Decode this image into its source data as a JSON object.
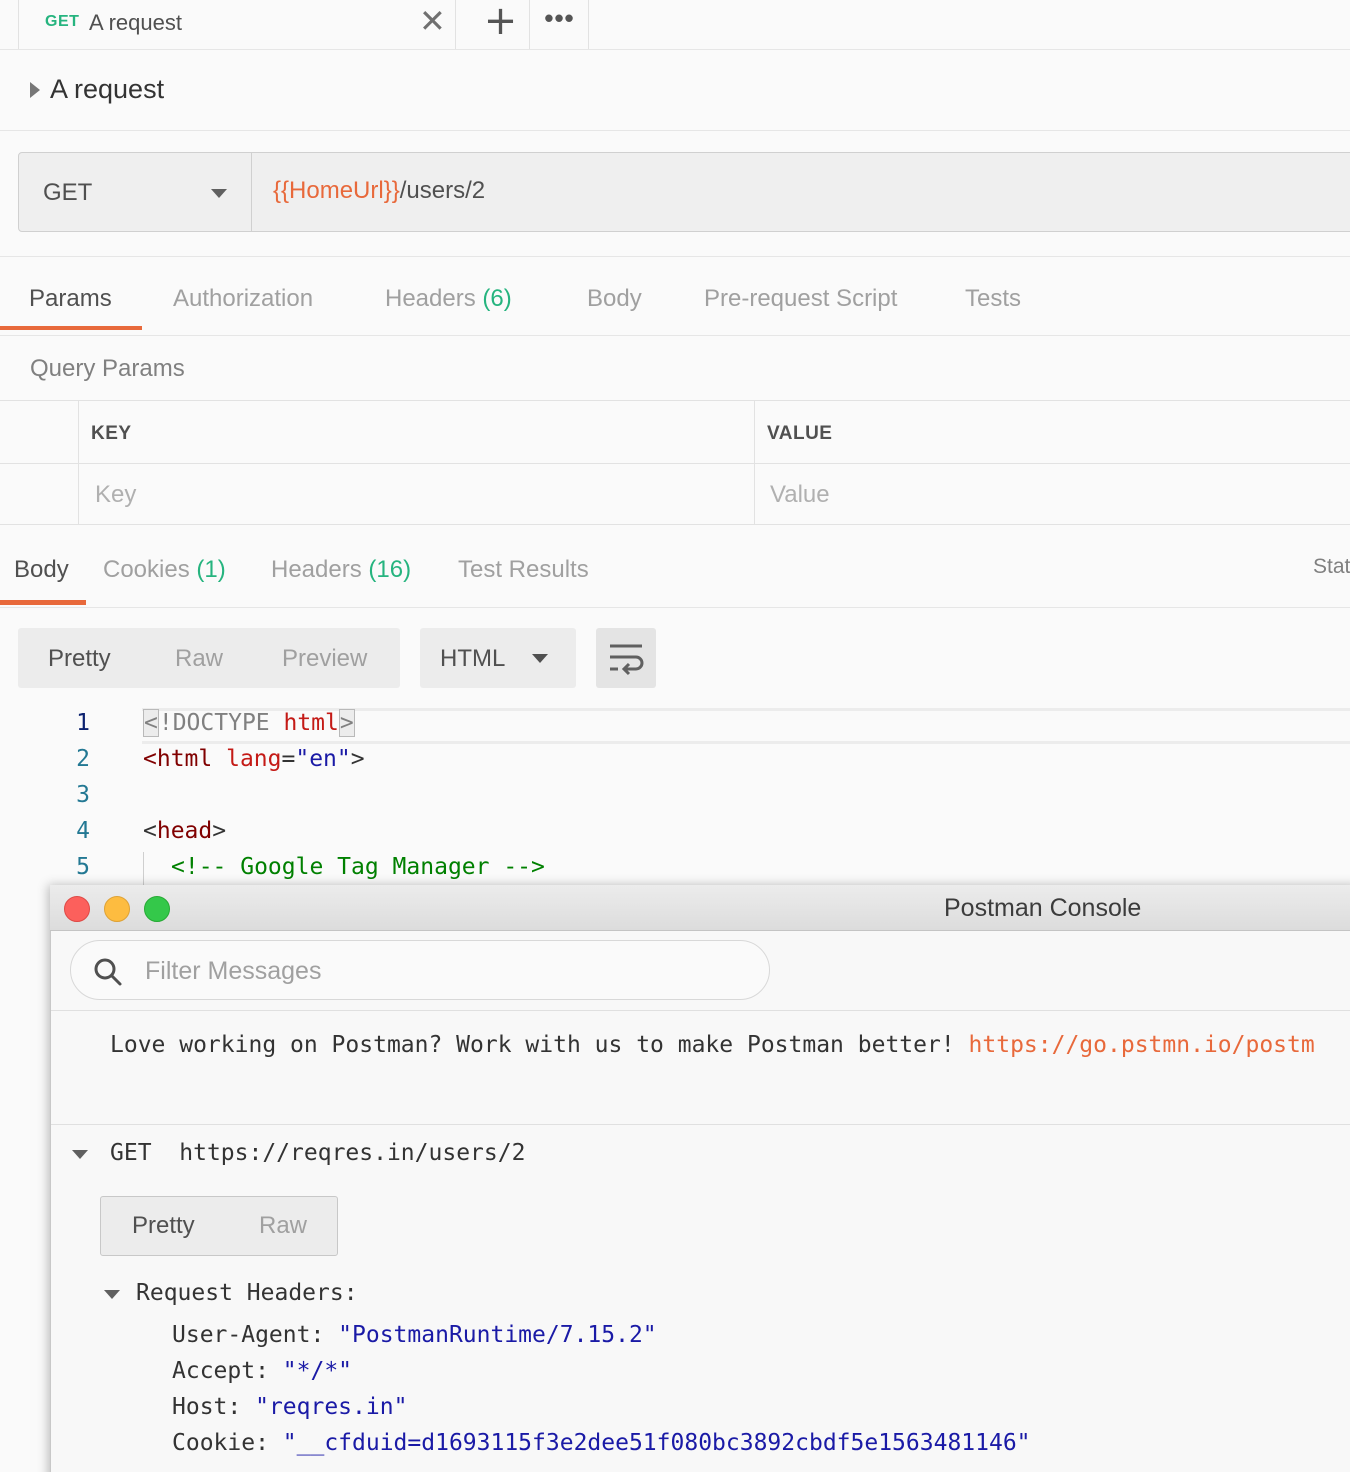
{
  "tab": {
    "method": "GET",
    "name": "A request",
    "close_glyph": "✕",
    "plus_glyph": "+",
    "more_glyph": "•••"
  },
  "request": {
    "title": "A request",
    "method": "GET",
    "url_var": "{{HomeUrl}}",
    "url_path": "/users/2"
  },
  "req_tabs": {
    "params": "Params",
    "authorization": "Authorization",
    "headers": "Headers",
    "headers_count": "(6)",
    "body": "Body",
    "prerequest": "Pre-request Script",
    "tests": "Tests"
  },
  "query_params": {
    "label": "Query Params",
    "key_header": "KEY",
    "value_header": "VALUE",
    "key_placeholder": "Key",
    "value_placeholder": "Value"
  },
  "resp_tabs": {
    "body": "Body",
    "cookies": "Cookies",
    "cookies_count": "(1)",
    "headers": "Headers",
    "headers_count": "(16)",
    "test_results": "Test Results",
    "status_trunc": "Stat"
  },
  "view": {
    "pretty": "Pretty",
    "raw": "Raw",
    "preview": "Preview",
    "language": "HTML"
  },
  "code": {
    "line_numbers": [
      "1",
      "2",
      "3",
      "4",
      "5"
    ],
    "l1_open": "<",
    "l1_doctype": "!DOCTYPE ",
    "l1_html": "html",
    "l1_close": ">",
    "l2_open": "<html ",
    "l2_attr": "lang",
    "l2_eq": "=",
    "l2_val": "\"en\"",
    "l2_close": ">",
    "l4_open": "<",
    "l4_tag": "head",
    "l4_close": ">",
    "l5_comment": "<!-- Google Tag Manager -->"
  },
  "console": {
    "title": "Postman Console",
    "filter_placeholder": "Filter Messages",
    "love_text": "Love working on Postman? Work with us to make Postman better! ",
    "love_link": "https://go.pstmn.io/postm",
    "log_method": "GET",
    "log_url": "https://reqres.in/users/2",
    "view_pretty": "Pretty",
    "view_raw": "Raw",
    "request_headers_label": "Request Headers:",
    "headers": [
      {
        "key": "User-Agent: ",
        "value": "\"PostmanRuntime/7.15.2\""
      },
      {
        "key": "Accept: ",
        "value": "\"*/*\""
      },
      {
        "key": "Host: ",
        "value": "\"reqres.in\""
      },
      {
        "key": "Cookie: ",
        "value": "\"__cfduid=d1693115f3e2dee51f080bc3892cbdf5e1563481146\""
      }
    ]
  },
  "colors": {
    "accent": "#e8693b",
    "method_green": "#26b47f",
    "traffic_red": "#fc605c",
    "traffic_yellow": "#fdbc40",
    "traffic_green": "#34c84a"
  }
}
